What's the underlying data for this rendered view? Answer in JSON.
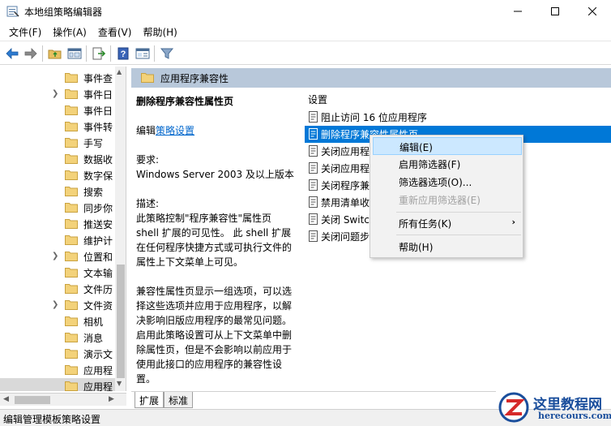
{
  "window": {
    "title": "本地组策略编辑器"
  },
  "menubar": {
    "items": [
      "文件(F)",
      "操作(A)",
      "查看(V)",
      "帮助(H)"
    ]
  },
  "tree": {
    "items": [
      {
        "label": "事件查",
        "arrow": false
      },
      {
        "label": "事件日",
        "arrow": true
      },
      {
        "label": "事件日",
        "arrow": false
      },
      {
        "label": "事件转",
        "arrow": false
      },
      {
        "label": "手写",
        "arrow": false
      },
      {
        "label": "数据收",
        "arrow": false
      },
      {
        "label": "数字保",
        "arrow": false
      },
      {
        "label": "搜索",
        "arrow": false
      },
      {
        "label": "同步你",
        "arrow": false
      },
      {
        "label": "推送安",
        "arrow": false
      },
      {
        "label": "维护计",
        "arrow": false
      },
      {
        "label": "位置和",
        "arrow": true
      },
      {
        "label": "文本输",
        "arrow": false
      },
      {
        "label": "文件历",
        "arrow": false
      },
      {
        "label": "文件资",
        "arrow": true
      },
      {
        "label": "相机",
        "arrow": false
      },
      {
        "label": "消息",
        "arrow": false
      },
      {
        "label": "演示文",
        "arrow": false
      },
      {
        "label": "应用程",
        "arrow": false
      },
      {
        "label": "应用程",
        "arrow": false,
        "selected": true
      }
    ]
  },
  "panel": {
    "header": "应用程序兼容性"
  },
  "description": {
    "heading": "删除程序兼容性属性页",
    "edit_prefix": "编辑",
    "edit_link": "策略设置",
    "requirement_label": "要求:",
    "requirement_value": "Windows Server 2003 及以上版本",
    "desc_label": "描述:",
    "desc_para1": "此策略控制\"程序兼容性\"属性页 shell 扩展的可见性。 此 shell 扩展在任何程序快捷方式或可执行文件的属性上下文菜单上可见。",
    "desc_para2": "兼容性属性页显示一组选项，可以选择这些选项并应用于应用程序，以解决影响旧版应用程序的最常见问题。启用此策略设置可从上下文菜单中删除属性页，但是不会影响以前应用于使用此接口的应用程序的兼容性设置。"
  },
  "list": {
    "column": "设置",
    "rows": [
      {
        "label": "阻止访问 16 位应用程序",
        "selected": false
      },
      {
        "label": "删除程序兼容性属性页",
        "selected": true
      },
      {
        "label": "关闭应用程",
        "selected": false
      },
      {
        "label": "关闭应用程",
        "selected": false
      },
      {
        "label": "关闭程序兼",
        "selected": false
      },
      {
        "label": "禁用清单收",
        "selected": false
      },
      {
        "label": "关闭 Switch",
        "selected": false
      },
      {
        "label": "关闭问题步",
        "selected": false
      }
    ]
  },
  "context_menu": {
    "items": [
      {
        "label": "编辑(E)",
        "highlighted": true
      },
      {
        "label": "启用筛选器(F)"
      },
      {
        "label": "筛选器选项(O)..."
      },
      {
        "label": "重新应用筛选器(E)",
        "disabled": true
      },
      {
        "label": "所有任务(K)",
        "submenu": true
      },
      {
        "label": "帮助(H)"
      }
    ]
  },
  "tabs": [
    "扩展",
    "标准"
  ],
  "statusbar": {
    "text": "编辑管理模板策略设置"
  },
  "watermark": {
    "title": "这里教程网",
    "url": "herecours.com"
  },
  "colors": {
    "accent": "#0078d7",
    "panel_header": "#b8c8da",
    "folder": "#e8c060",
    "menu_highlight": "#cce8ff"
  }
}
